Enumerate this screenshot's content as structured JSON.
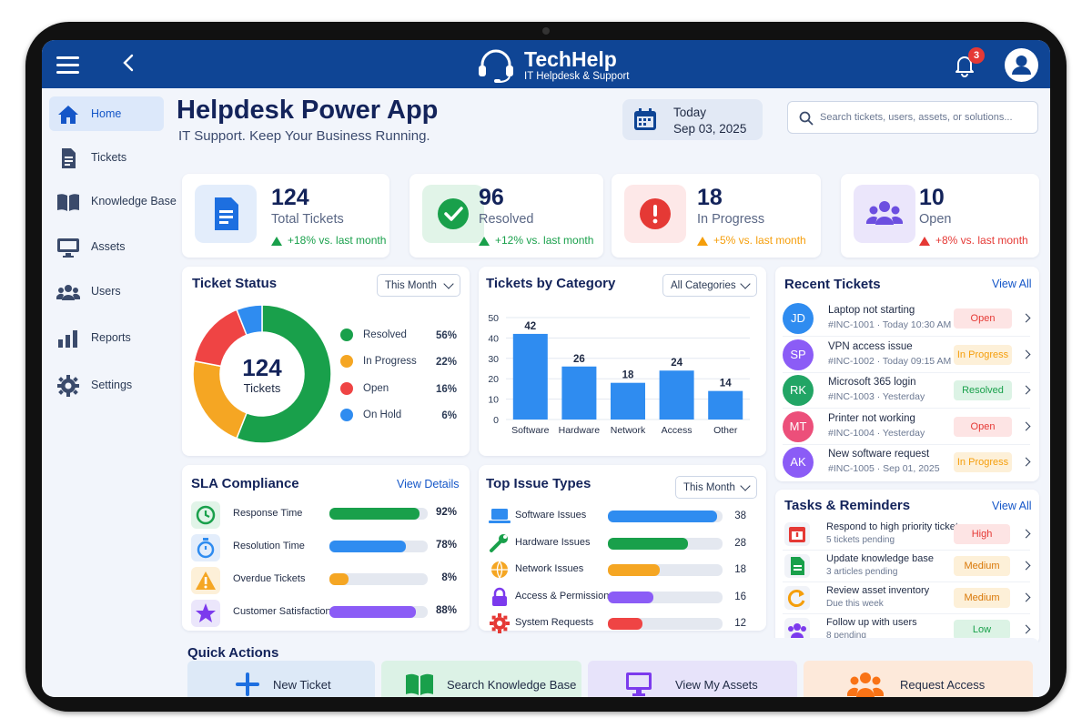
{
  "app": {
    "title": "TechHelp",
    "subtitle": "IT Helpdesk & Support",
    "notifications": "3"
  },
  "colors": {
    "brand": "#0f4595",
    "accent": "#1456c8",
    "green": "#19a04b",
    "orange": "#f59e0b",
    "red": "#e53935",
    "blue": "#2f80ed",
    "purple": "#7c5cf0"
  },
  "sidebar": {
    "items": [
      {
        "label": "Home",
        "icon": "home-icon"
      },
      {
        "label": "Tickets",
        "icon": "document-icon"
      },
      {
        "label": "Knowledge Base",
        "icon": "book-icon"
      },
      {
        "label": "Assets",
        "icon": "monitor-icon"
      },
      {
        "label": "Users",
        "icon": "users-icon"
      },
      {
        "label": "Reports",
        "icon": "bar-chart-icon"
      },
      {
        "label": "Settings",
        "icon": "gear-icon"
      }
    ]
  },
  "header": {
    "title": "Helpdesk Power App",
    "subtitle": "IT Support. Keep Your Business Running.",
    "date_label": "Today",
    "date": "Sep 03, 2025",
    "search_placeholder": "Search tickets, users, assets, or solutions..."
  },
  "stats": [
    {
      "value": "124",
      "label": "Total Tickets",
      "trend": "+18% vs. last month"
    },
    {
      "value": "96",
      "label": "Resolved",
      "trend": "+12% vs. last month"
    },
    {
      "value": "18",
      "label": "In Progress",
      "trend": "+5% vs. last month"
    },
    {
      "value": "10",
      "label": "Open",
      "trend": "+8% vs. last month"
    }
  ],
  "ticket_status": {
    "title": "Ticket Status",
    "filter": "This Month",
    "center_value": "124",
    "center_label": "Tickets",
    "legend": [
      {
        "label": "Resolved",
        "value": "56%"
      },
      {
        "label": "In Progress",
        "value": "22%"
      },
      {
        "label": "Open",
        "value": "16%"
      },
      {
        "label": "On Hold",
        "value": "6%"
      }
    ]
  },
  "by_category": {
    "title": "Tickets by Category",
    "filter": "All Categories"
  },
  "chart_data": [
    {
      "type": "pie",
      "title": "Ticket Status",
      "categories": [
        "Resolved",
        "In Progress",
        "Open",
        "On Hold"
      ],
      "values": [
        56,
        22,
        16,
        6
      ],
      "colors": [
        "#19a04b",
        "#f5a623",
        "#ef4444",
        "#2f8cf0"
      ]
    },
    {
      "type": "bar",
      "title": "Tickets by Category",
      "categories": [
        "Software",
        "Hardware",
        "Network",
        "Access",
        "Other"
      ],
      "values": [
        42,
        26,
        18,
        24,
        14
      ],
      "ylim": [
        0,
        50
      ],
      "yticks": [
        "0",
        "10",
        "20",
        "30",
        "40",
        "50"
      ],
      "grid": true
    }
  ],
  "recent": {
    "title": "Recent Tickets",
    "view_all": "View All",
    "items": [
      {
        "initials": "JD",
        "title": "Laptop not starting",
        "sub": "#INC-1001 · Today 10:30 AM",
        "status": "Open"
      },
      {
        "initials": "SP",
        "title": "VPN access issue",
        "sub": "#INC-1002 · Today 09:15 AM",
        "status": "In Progress"
      },
      {
        "initials": "RK",
        "title": "Microsoft 365 login",
        "sub": "#INC-1003 · Yesterday",
        "status": "Resolved"
      },
      {
        "initials": "MT",
        "title": "Printer not working",
        "sub": "#INC-1004 · Yesterday",
        "status": "Open"
      },
      {
        "initials": "AK",
        "title": "New software request",
        "sub": "#INC-1005 · Sep 01, 2025",
        "status": "In Progress"
      }
    ]
  },
  "sla": {
    "title": "SLA Compliance",
    "link": "View Details",
    "items": [
      {
        "label": "Response Time",
        "value": "92%",
        "fraction": 0.92
      },
      {
        "label": "Resolution Time",
        "value": "78%",
        "fraction": 0.78
      },
      {
        "label": "Overdue Tickets",
        "value": "8%",
        "fraction": 0.19
      },
      {
        "label": "Customer Satisfaction",
        "value": "88%",
        "fraction": 0.88
      }
    ]
  },
  "top_issues": {
    "title": "Top Issue Types",
    "filter": "This Month",
    "items": [
      {
        "label": "Software Issues",
        "value": "38",
        "count": 38
      },
      {
        "label": "Hardware Issues",
        "value": "28",
        "count": 28
      },
      {
        "label": "Network Issues",
        "value": "18",
        "count": 18
      },
      {
        "label": "Access & Permissions",
        "value": "16",
        "count": 16
      },
      {
        "label": "System Requests",
        "value": "12",
        "count": 12
      }
    ]
  },
  "tasks": {
    "title": "Tasks & Reminders",
    "view_all": "View All",
    "items": [
      {
        "title": "Respond to high priority tickets",
        "sub": "5 tickets pending",
        "priority": "High"
      },
      {
        "title": "Update knowledge base",
        "sub": "3 articles pending",
        "priority": "Medium"
      },
      {
        "title": "Review asset inventory",
        "sub": "Due this week",
        "priority": "Medium"
      },
      {
        "title": "Follow up with users",
        "sub": "8 pending",
        "priority": "Low"
      }
    ]
  },
  "quick_actions": {
    "title": "Quick Actions",
    "items": [
      {
        "label": "New Ticket"
      },
      {
        "label": "Search Knowledge Base"
      },
      {
        "label": "View My Assets"
      },
      {
        "label": "Request Access"
      }
    ]
  }
}
